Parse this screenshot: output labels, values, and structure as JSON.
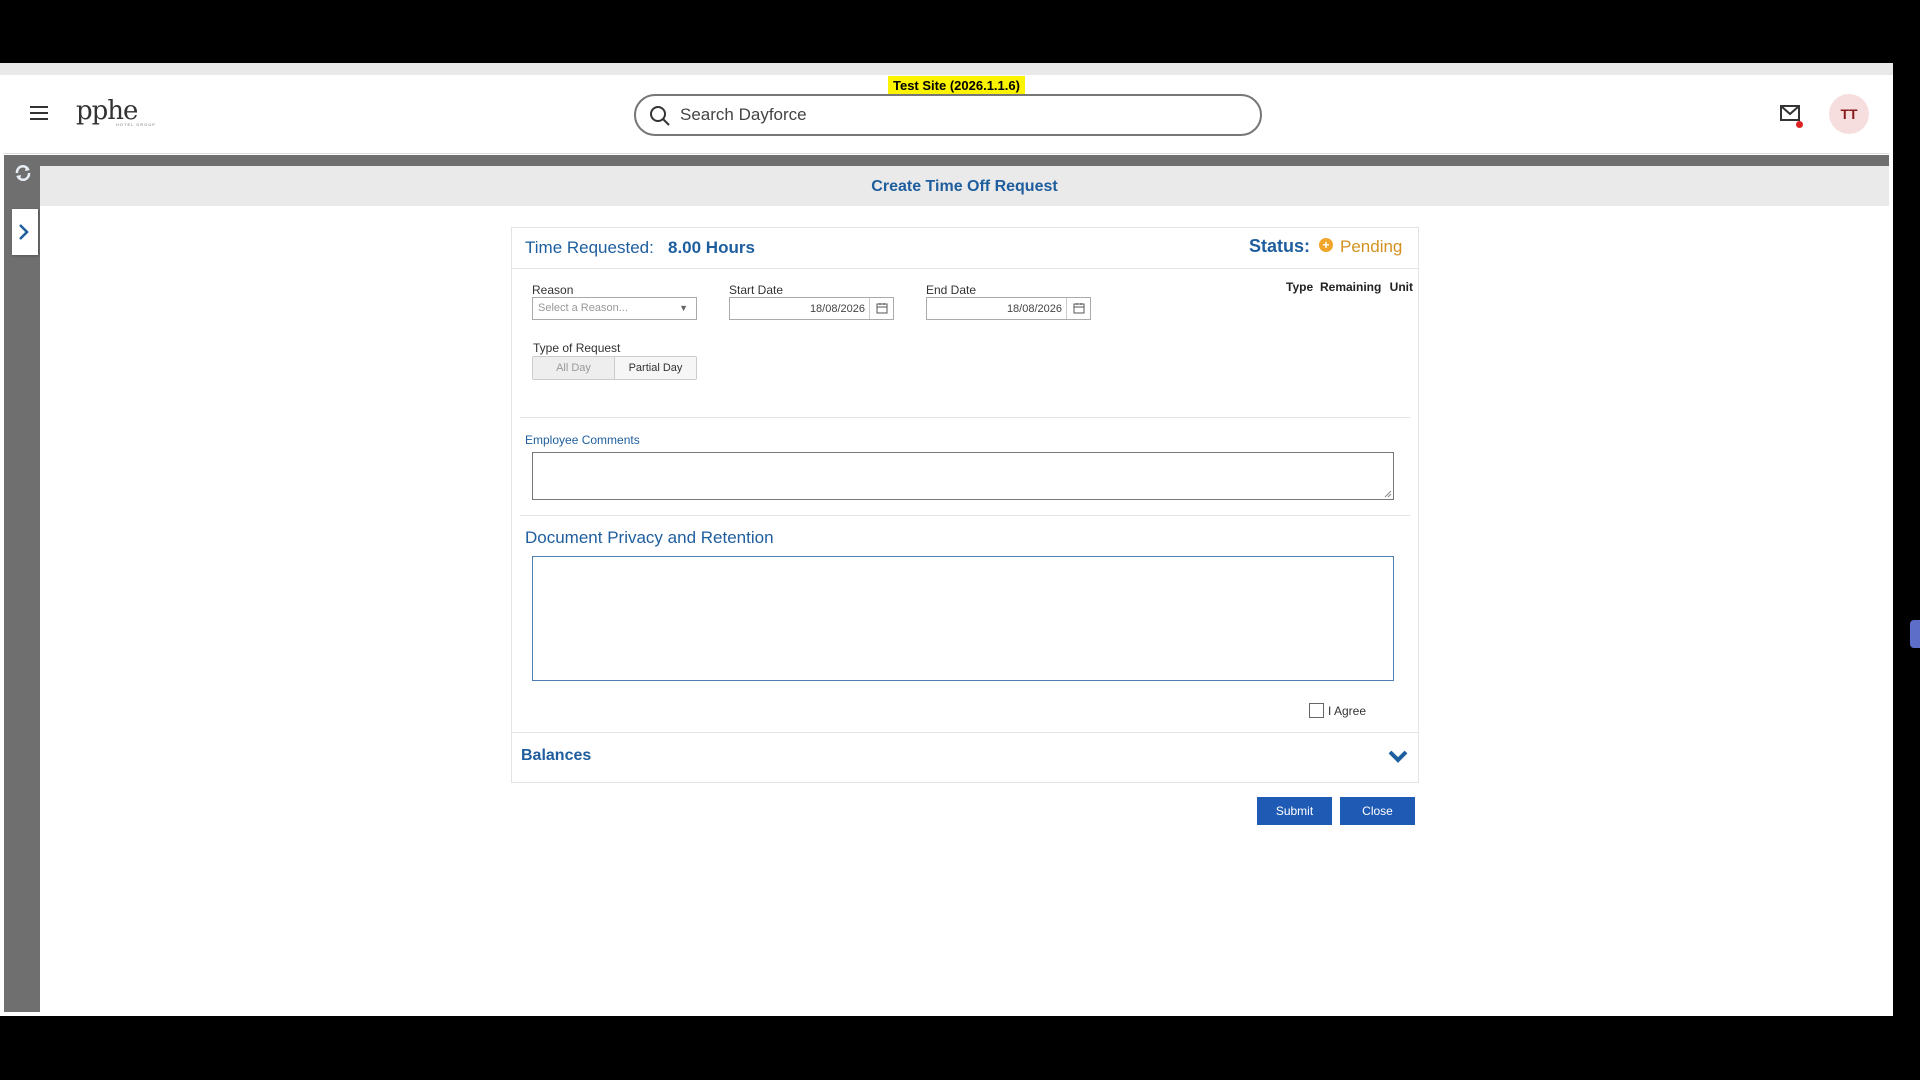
{
  "header": {
    "test_badge": "Test Site (2026.1.1.6)",
    "logo_text": "pphe",
    "logo_subtext": "HOTEL GROUP",
    "search_placeholder": "Search Dayforce",
    "avatar_initials": "TT"
  },
  "page": {
    "title": "Create Time Off Request"
  },
  "request": {
    "time_requested_label": "Time Requested:",
    "time_requested_value": "8.00 Hours",
    "status_label": "Status:",
    "status_value": "Pending",
    "status_icon": "plus-circle-icon",
    "reason_label": "Reason",
    "reason_placeholder": "Select a Reason...",
    "start_date_label": "Start Date",
    "start_date_value": "18/08/2026",
    "end_date_label": "End Date",
    "end_date_value": "18/08/2026",
    "columns": [
      "Type",
      "Remaining",
      "Unit"
    ],
    "type_of_request_label": "Type of Request",
    "type_options": [
      "All Day",
      "Partial Day"
    ],
    "type_selected": "Partial Day",
    "employee_comments_label": "Employee Comments",
    "employee_comments_value": "",
    "privacy_label": "Document Privacy and Retention",
    "agree_label": "I Agree",
    "agree_checked": false,
    "balances_label": "Balances"
  },
  "actions": {
    "submit_label": "Submit",
    "close_label": "Close"
  },
  "colors": {
    "accent": "#1e5e9e",
    "button": "#1f5bb5",
    "pending": "#f2a52b",
    "test_badge": "#fbf300"
  }
}
